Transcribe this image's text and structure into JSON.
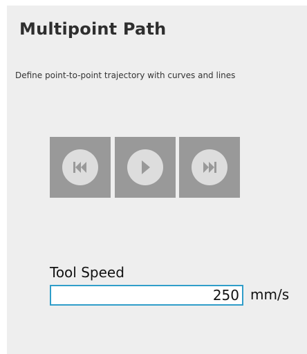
{
  "header": {
    "title": "Multipoint Path",
    "description": "Define point-to-point trajectory with curves and lines"
  },
  "playback": {
    "buttons": [
      {
        "name": "skip-to-start",
        "icon": "skip-back-icon"
      },
      {
        "name": "play",
        "icon": "play-icon"
      },
      {
        "name": "skip-to-end",
        "icon": "skip-forward-icon"
      }
    ],
    "colors": {
      "button_bg": "#999999",
      "icon_circle": "#dddddd",
      "icon_glyph": "#999999"
    }
  },
  "tool_speed": {
    "label": "Tool Speed",
    "value": "250",
    "unit": "mm/s",
    "border_color": "#2f9dc9"
  }
}
